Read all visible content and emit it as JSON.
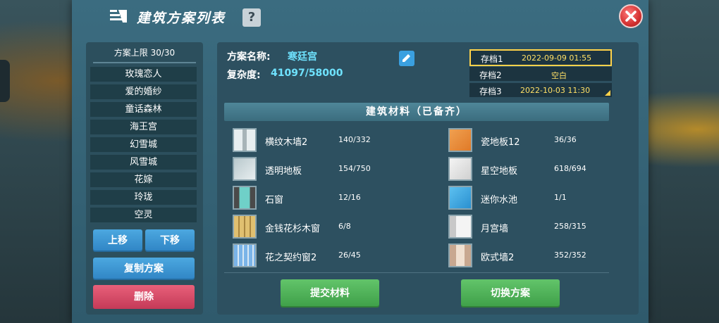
{
  "window": {
    "title": "建筑方案列表",
    "help_label": "?"
  },
  "plan_list": {
    "header": "方案上限 30/30",
    "items": [
      "玫瑰恋人",
      "爱的婚纱",
      "童话森林",
      "海王宫",
      "幻雪城",
      "风雪城",
      "花嫁",
      "玲珑",
      "空灵"
    ],
    "move_up": "上移",
    "move_down": "下移",
    "copy": "复制方案",
    "delete": "删除"
  },
  "plan": {
    "name_label": "方案名称:",
    "name_value": "寒廷宫",
    "complexity_label": "复杂度:",
    "complexity_value": "41097/58000"
  },
  "save_slots": [
    {
      "name": "存档1",
      "date": "2022-09-09 01:55",
      "active": true
    },
    {
      "name": "存档2",
      "date": "空白",
      "active": false
    },
    {
      "name": "存档3",
      "date": "2022-10-03 11:30",
      "active": false
    }
  ],
  "materials": {
    "header": "建筑材料（已备齐）",
    "left": [
      {
        "name": "横纹木墙2",
        "count": "140/332",
        "icon": "striped-wood-wall-icon"
      },
      {
        "name": "透明地板",
        "count": "154/750",
        "icon": "transparent-floor-icon"
      },
      {
        "name": "石窗",
        "count": "12/16",
        "icon": "stone-window-icon"
      },
      {
        "name": "金钱花杉木窗",
        "count": "6/8",
        "icon": "golden-fir-window-icon"
      },
      {
        "name": "花之契约窗2",
        "count": "26/45",
        "icon": "flower-window-icon"
      }
    ],
    "right": [
      {
        "name": "瓷地板12",
        "count": "36/36",
        "icon": "porcelain-floor-icon"
      },
      {
        "name": "星空地板",
        "count": "618/694",
        "icon": "starry-floor-icon"
      },
      {
        "name": "迷你水池",
        "count": "1/1",
        "icon": "mini-pool-icon"
      },
      {
        "name": "月宫墙",
        "count": "258/315",
        "icon": "moon-palace-wall-icon"
      },
      {
        "name": "欧式墙2",
        "count": "352/352",
        "icon": "european-wall-icon"
      }
    ]
  },
  "actions": {
    "submit": "提交材料",
    "switch": "切换方案"
  },
  "colors": {
    "accent_cyan": "#6fe3ff",
    "slot_gold": "#ffd24a",
    "button_green": "#3e9f48",
    "button_blue": "#2f84c4",
    "button_red": "#c43a58"
  }
}
